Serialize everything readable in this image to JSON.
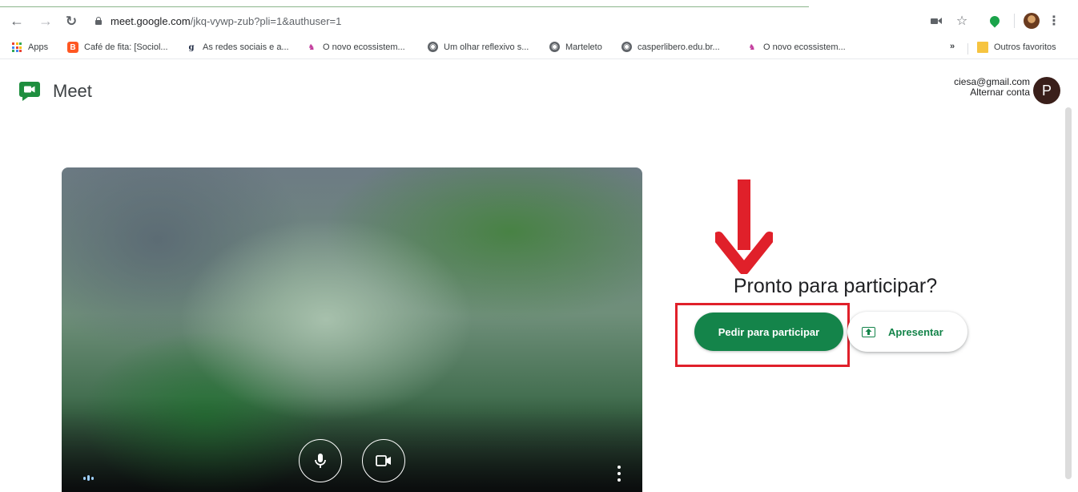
{
  "browser": {
    "url_host": "meet.google.com",
    "url_path": "/jkq-vywp-zub?pli=1&authuser=1",
    "icons": {
      "back": "back-arrow-icon",
      "forward": "forward-arrow-icon",
      "reload": "reload-icon",
      "star": "star-icon",
      "menu": "kebab-menu-icon"
    }
  },
  "bookmarks": {
    "items": [
      {
        "label": "Apps",
        "icon": "apps-grid-icon"
      },
      {
        "label": "Café de fita: [Sociol...",
        "icon": "blogger-icon"
      },
      {
        "label": "As redes sociais e a...",
        "icon": "g-icon"
      },
      {
        "label": "O novo ecossistem...",
        "icon": "unicorn-icon"
      },
      {
        "label": "Um olhar reflexivo s...",
        "icon": "globe-icon"
      },
      {
        "label": "Marteleto",
        "icon": "globe-icon"
      },
      {
        "label": "casperlibero.edu.br...",
        "icon": "globe-icon"
      },
      {
        "label": "O novo ecossistem...",
        "icon": "unicorn-icon"
      }
    ],
    "overflow": "»",
    "other": "Outros favoritos"
  },
  "meet": {
    "title": "Meet",
    "account_email": "ciesa@gmail.com",
    "switch_account": "Alternar conta",
    "avatar_letter": "P"
  },
  "join": {
    "heading": "Pronto para participar?",
    "ask_to_join": "Pedir para participar",
    "present": "Apresentar"
  },
  "colors": {
    "join_green": "#14844a",
    "highlight_red": "#e0202a"
  }
}
